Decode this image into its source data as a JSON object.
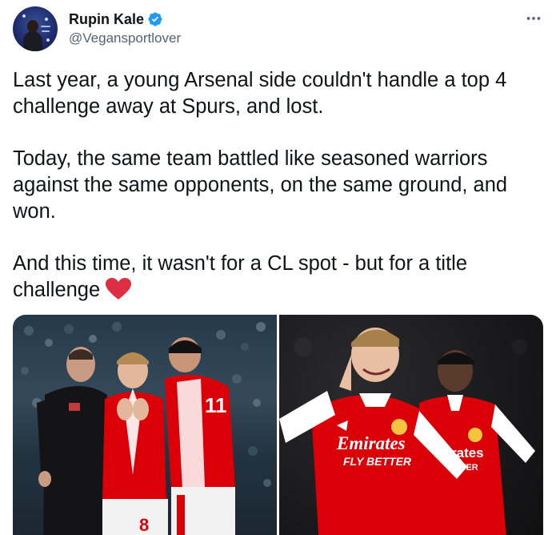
{
  "tweet": {
    "display_name": "Rupin Kale",
    "handle": "@Vegansportlover",
    "more_icon": "more-horizontal-icon",
    "verified_color": "#1d9bf0",
    "paragraphs": [
      "Last year, a young Arsenal side couldn't handle a top 4 challenge away at Spurs, and lost.",
      "Today, the same team battled like seasoned warriors against the same opponents, on the same ground, and won.",
      "And this time, it wasn't for a CL spot - but for a title challenge"
    ],
    "emoji": "❤️",
    "media": [
      {
        "shirt_sponsor": "",
        "number": "8",
        "number2": "11"
      },
      {
        "sponsor_line1": "Emirates",
        "sponsor_line2": "FLY BETTER",
        "sponsor_partial1": "rates",
        "sponsor_partial2": "TTER"
      }
    ]
  },
  "colors": {
    "arsenal_red": "#db0007",
    "text": "#0f1419",
    "secondary": "#536471",
    "heart": "#e0245e"
  }
}
